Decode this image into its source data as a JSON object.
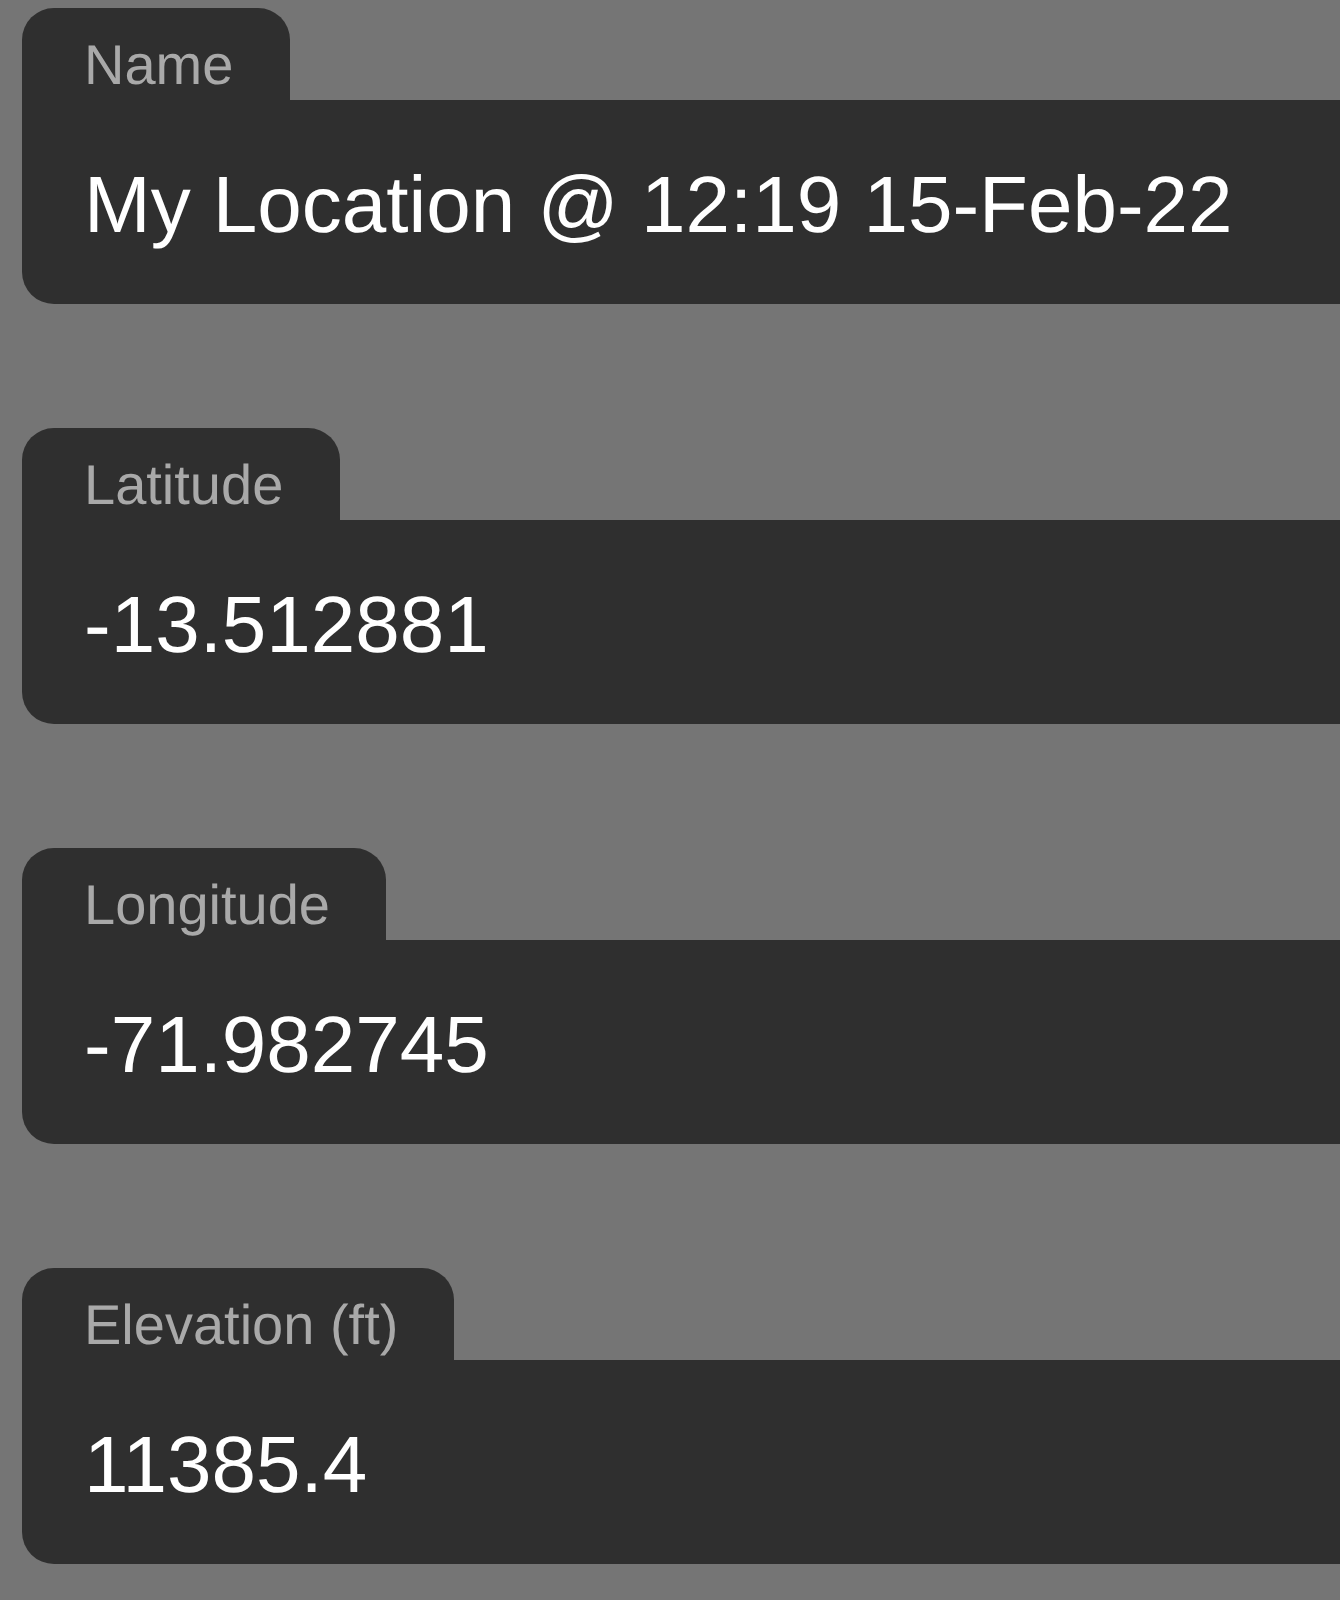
{
  "fields": [
    {
      "label": "Name",
      "value": "My Location @ 12:19 15-Feb-22"
    },
    {
      "label": "Latitude",
      "value": "-13.512881"
    },
    {
      "label": "Longitude",
      "value": "-71.982745"
    },
    {
      "label": "Elevation (ft)",
      "value": "11385.4"
    }
  ]
}
